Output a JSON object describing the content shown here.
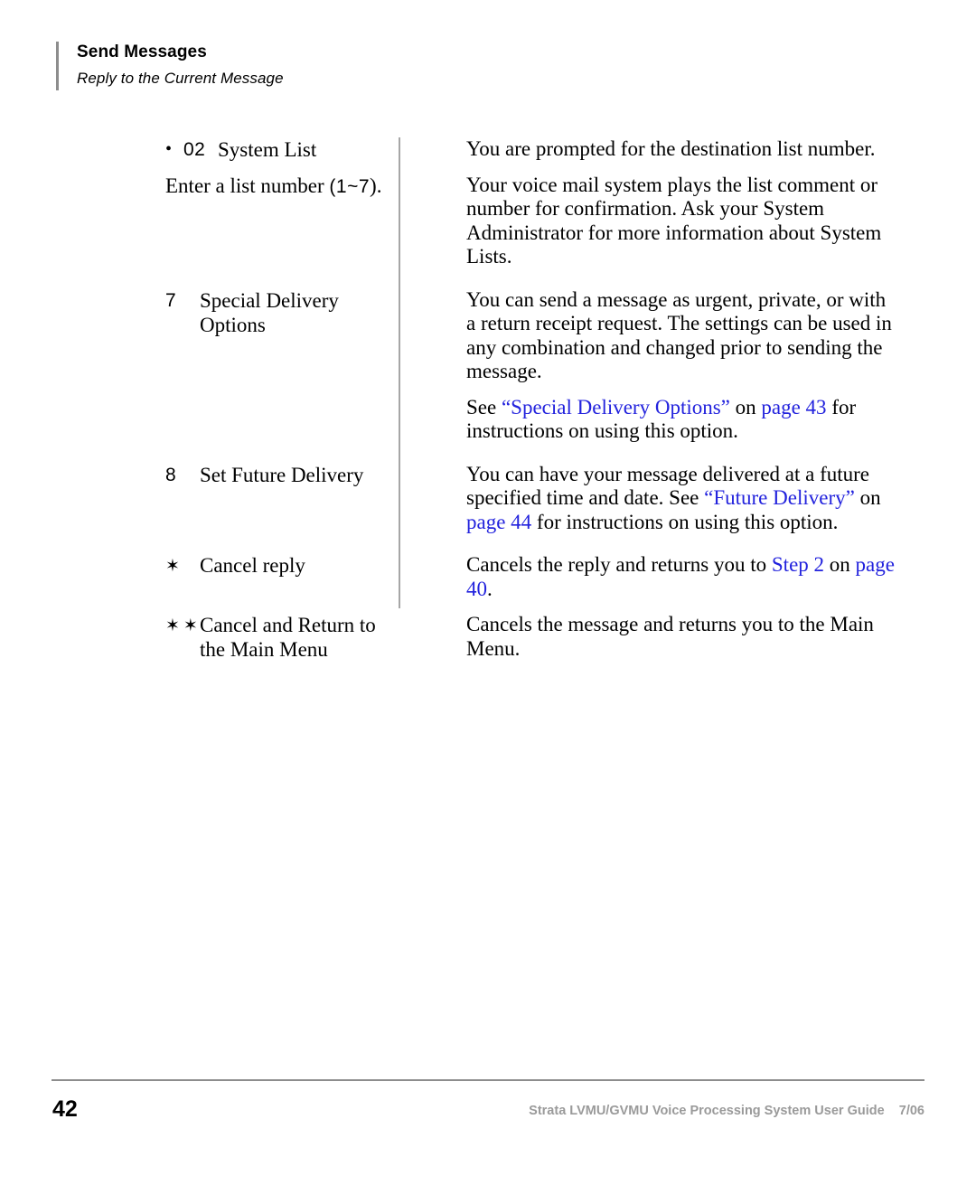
{
  "header": {
    "title": "Send Messages",
    "subtitle": "Reply to the Current Message",
    "rule_color": "#8d8d8d"
  },
  "colors": {
    "link": "#2222dd",
    "rule": "#8d8d8d",
    "divider": "#a6a6a6",
    "footer_text": "#9a9a9a"
  },
  "rows": [
    {
      "bullet": "•",
      "key": "02",
      "label": "System List",
      "sub_prefix": "Enter a list number ",
      "sub_suffix": ").",
      "sub_mono": "(1~7",
      "right_p1": "You are prompted for the destination list number.",
      "right_p2": "Your voice mail system plays the list comment or number for confirmation. Ask your System Administrator for more information about System Lists."
    },
    {
      "key": "7",
      "label": "Special Delivery Options",
      "right_p1": "You can send a message as urgent, private, or with a return receipt request. The settings can be used in any combination and changed prior to sending the message.",
      "right_p2_pre": "See ",
      "right_p2_link1": "“Special Delivery Options”",
      "right_p2_mid": " on ",
      "right_p2_link2": "page 43",
      "right_p2_post": " for instructions on using this option."
    },
    {
      "key": "8",
      "label": "Set Future Delivery",
      "right_pre": "You can have your message delivered at a future specified time and date. See ",
      "right_link1": "“Future Delivery”",
      "right_mid": " on ",
      "right_link2": "page 44",
      "right_post": " for instructions on using this option."
    },
    {
      "star": "✶",
      "label": "Cancel reply",
      "right_pre": "Cancels the reply and returns you to ",
      "right_link1": "Step 2",
      "right_mid": " on ",
      "right_link2": "page 40",
      "right_post": "."
    },
    {
      "star": "✶✶",
      "label": "Cancel and Return to the Main Menu",
      "right_p1": "Cancels the message and returns you to the Main Menu."
    }
  ],
  "footer": {
    "page_number": "42",
    "note": "Strata LVMU/GVMU Voice Processing System User Guide    7/06"
  }
}
